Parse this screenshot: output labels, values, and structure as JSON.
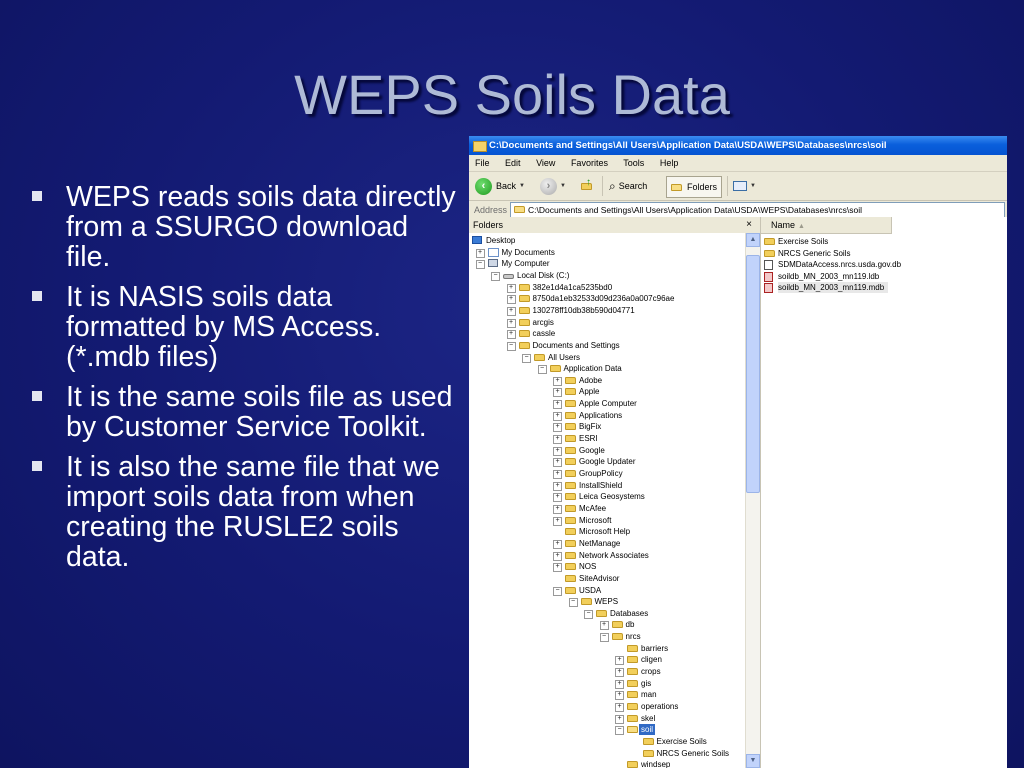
{
  "slide": {
    "title": "WEPS Soils Data",
    "bullets": [
      "WEPS reads soils data directly from a SSURGO download file.",
      "It is NASIS soils data formatted by MS Access. (*.mdb files)",
      "It is the same soils file as used by Customer Service Toolkit.",
      "It is also the same file that we import soils data from when creating the RUSLE2 soils data."
    ]
  },
  "window": {
    "title": "C:\\Documents and Settings\\All Users\\Application Data\\USDA\\WEPS\\Databases\\nrcs\\soil",
    "menu": [
      "File",
      "Edit",
      "View",
      "Favorites",
      "Tools",
      "Help"
    ],
    "toolbar": {
      "back": "Back",
      "search": "Search",
      "folders": "Folders"
    },
    "address": {
      "label": "Address",
      "value": "C:\\Documents and Settings\\All Users\\Application Data\\USDA\\WEPS\\Databases\\nrcs\\soil"
    },
    "folders_header": "Folders",
    "close_glyph": "×",
    "name_column": "Name",
    "tree": [
      {
        "label": "Desktop",
        "depth": 0,
        "icon": "desktop",
        "exp": ""
      },
      {
        "label": "My Documents",
        "depth": 1,
        "icon": "mydocs",
        "exp": "+"
      },
      {
        "label": "My Computer",
        "depth": 1,
        "icon": "mycomputer",
        "exp": "-"
      },
      {
        "label": "Local Disk (C:)",
        "depth": 2,
        "icon": "disk",
        "exp": "-"
      },
      {
        "label": "382e1d4a1ca5235bd0",
        "depth": 3,
        "icon": "folder",
        "exp": "+"
      },
      {
        "label": "8750da1eb32533d09d236a0a007c96ae",
        "depth": 3,
        "icon": "folder",
        "exp": "+"
      },
      {
        "label": "130278ff10db38b590d04771",
        "depth": 3,
        "icon": "folder",
        "exp": "+"
      },
      {
        "label": "arcgis",
        "depth": 3,
        "icon": "folder",
        "exp": "+"
      },
      {
        "label": "cassle",
        "depth": 3,
        "icon": "folder",
        "exp": "+"
      },
      {
        "label": "Documents and Settings",
        "depth": 3,
        "icon": "folder",
        "exp": "-"
      },
      {
        "label": "All Users",
        "depth": 4,
        "icon": "folder",
        "exp": "-"
      },
      {
        "label": "Application Data",
        "depth": 5,
        "icon": "folder",
        "exp": "-"
      },
      {
        "label": "Adobe",
        "depth": 6,
        "icon": "folder",
        "exp": "+"
      },
      {
        "label": "Apple",
        "depth": 6,
        "icon": "folder",
        "exp": "+"
      },
      {
        "label": "Apple Computer",
        "depth": 6,
        "icon": "folder",
        "exp": "+"
      },
      {
        "label": "Applications",
        "depth": 6,
        "icon": "folder",
        "exp": "+"
      },
      {
        "label": "BigFix",
        "depth": 6,
        "icon": "folder",
        "exp": "+"
      },
      {
        "label": "ESRI",
        "depth": 6,
        "icon": "folder",
        "exp": "+"
      },
      {
        "label": "Google",
        "depth": 6,
        "icon": "folder",
        "exp": "+"
      },
      {
        "label": "Google Updater",
        "depth": 6,
        "icon": "folder",
        "exp": "+"
      },
      {
        "label": "GroupPolicy",
        "depth": 6,
        "icon": "folder",
        "exp": "+"
      },
      {
        "label": "InstallShield",
        "depth": 6,
        "icon": "folder",
        "exp": "+"
      },
      {
        "label": "Leica Geosystems",
        "depth": 6,
        "icon": "folder",
        "exp": "+"
      },
      {
        "label": "McAfee",
        "depth": 6,
        "icon": "folder",
        "exp": "+"
      },
      {
        "label": "Microsoft",
        "depth": 6,
        "icon": "folder",
        "exp": "+"
      },
      {
        "label": "Microsoft Help",
        "depth": 6,
        "icon": "folder",
        "exp": ""
      },
      {
        "label": "NetManage",
        "depth": 6,
        "icon": "folder",
        "exp": "+"
      },
      {
        "label": "Network Associates",
        "depth": 6,
        "icon": "folder",
        "exp": "+"
      },
      {
        "label": "NOS",
        "depth": 6,
        "icon": "folder",
        "exp": "+"
      },
      {
        "label": "SiteAdvisor",
        "depth": 6,
        "icon": "folder",
        "exp": ""
      },
      {
        "label": "USDA",
        "depth": 6,
        "icon": "folder",
        "exp": "-"
      },
      {
        "label": "WEPS",
        "depth": 7,
        "icon": "folder",
        "exp": "-"
      },
      {
        "label": "Databases",
        "depth": 8,
        "icon": "folder",
        "exp": "-"
      },
      {
        "label": "db",
        "depth": 9,
        "icon": "folder",
        "exp": "+"
      },
      {
        "label": "nrcs",
        "depth": 9,
        "icon": "folder",
        "exp": "-"
      },
      {
        "label": "barriers",
        "depth": 10,
        "icon": "folder",
        "exp": ""
      },
      {
        "label": "cligen",
        "depth": 10,
        "icon": "folder",
        "exp": "+"
      },
      {
        "label": "crops",
        "depth": 10,
        "icon": "folder",
        "exp": "+"
      },
      {
        "label": "gis",
        "depth": 10,
        "icon": "folder",
        "exp": "+"
      },
      {
        "label": "man",
        "depth": 10,
        "icon": "folder",
        "exp": "+"
      },
      {
        "label": "operations",
        "depth": 10,
        "icon": "folder",
        "exp": "+"
      },
      {
        "label": "skel",
        "depth": 10,
        "icon": "folder",
        "exp": "+"
      },
      {
        "label": "soil",
        "depth": 10,
        "icon": "folder-open",
        "exp": "-",
        "selected": true
      },
      {
        "label": "Exercise Soils",
        "depth": 11,
        "icon": "folder",
        "exp": ""
      },
      {
        "label": "NRCS Generic Soils",
        "depth": 11,
        "icon": "folder",
        "exp": ""
      },
      {
        "label": "windsep",
        "depth": 10,
        "icon": "folder",
        "exp": ""
      }
    ],
    "files": [
      {
        "name": "Exercise Soils",
        "icon": "folder"
      },
      {
        "name": "NRCS Generic Soils",
        "icon": "folder"
      },
      {
        "name": "SDMDataAccess.nrcs.usda.gov.db",
        "icon": "db"
      },
      {
        "name": "soildb_MN_2003_mn119.ldb",
        "icon": "mdb"
      },
      {
        "name": "soildb_MN_2003_mn119.mdb",
        "icon": "mdb",
        "highlight": true
      }
    ]
  }
}
